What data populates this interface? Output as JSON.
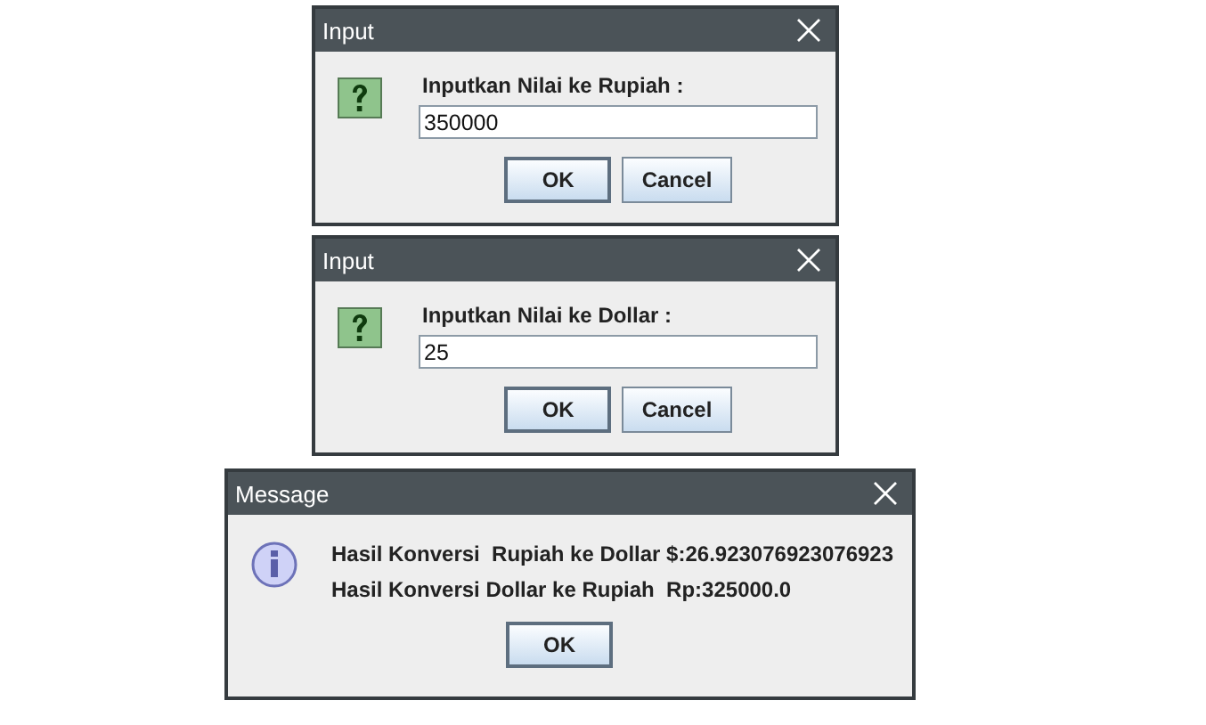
{
  "dialogs": [
    {
      "kind": "input",
      "title": "Input",
      "prompt": "Inputkan Nilai ke Rupiah :",
      "value": "350000",
      "buttons": [
        "OK",
        "Cancel"
      ]
    },
    {
      "kind": "input",
      "title": "Input",
      "prompt": "Inputkan Nilai ke Dollar :",
      "value": "25",
      "buttons": [
        "OK",
        "Cancel"
      ]
    },
    {
      "kind": "message",
      "title": "Message",
      "lines": [
        "Hasil Konversi  Rupiah ke Dollar $:26.923076923076923",
        "Hasil Konversi Dollar ke Rupiah  Rp:325000.0"
      ],
      "buttons": [
        "OK"
      ]
    }
  ]
}
